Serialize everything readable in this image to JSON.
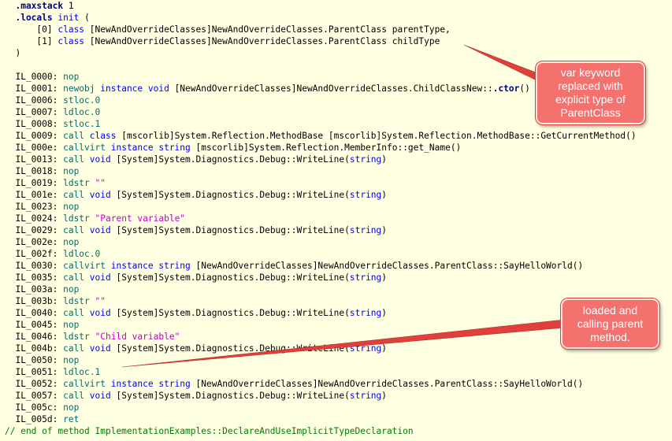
{
  "code_lines": [
    [
      [
        "t-dir",
        "  .maxstack"
      ],
      [
        "t-dk",
        " 1"
      ]
    ],
    [
      [
        "t-dir",
        "  .locals"
      ],
      [
        "t-dk",
        " "
      ],
      [
        "t-kw",
        "init"
      ],
      [
        "t-dk",
        " ("
      ]
    ],
    [
      [
        "t-dk",
        "      [0] "
      ],
      [
        "t-kw",
        "class"
      ],
      [
        "t-dk",
        " [NewAndOverrideClasses]NewAndOverrideClasses.ParentClass parentType,"
      ]
    ],
    [
      [
        "t-dk",
        "      [1] "
      ],
      [
        "t-kw",
        "class"
      ],
      [
        "t-dk",
        " [NewAndOverrideClasses]NewAndOverrideClasses.ParentClass childType"
      ]
    ],
    [
      [
        "t-dk",
        "  )"
      ]
    ],
    [
      [
        "t-dk",
        ""
      ]
    ],
    [
      [
        "t-dk",
        "  IL_0000: "
      ],
      [
        "t-op",
        "nop"
      ]
    ],
    [
      [
        "t-dk",
        "  IL_0001: "
      ],
      [
        "t-op",
        "newobj"
      ],
      [
        "t-dk",
        " "
      ],
      [
        "t-kw",
        "instance void"
      ],
      [
        "t-dk",
        " [NewAndOverrideClasses]NewAndOverrideClasses.ChildClassNew::"
      ],
      [
        "t-dir",
        ".ctor"
      ],
      [
        "t-dk",
        "()"
      ]
    ],
    [
      [
        "t-dk",
        "  IL_0006: "
      ],
      [
        "t-op",
        "stloc.0"
      ]
    ],
    [
      [
        "t-dk",
        "  IL_0007: "
      ],
      [
        "t-op",
        "ldloc.0"
      ]
    ],
    [
      [
        "t-dk",
        "  IL_0008: "
      ],
      [
        "t-op",
        "stloc.1"
      ]
    ],
    [
      [
        "t-dk",
        "  IL_0009: "
      ],
      [
        "t-op",
        "call"
      ],
      [
        "t-dk",
        " "
      ],
      [
        "t-kw",
        "class"
      ],
      [
        "t-dk",
        " [mscorlib]System.Reflection.MethodBase [mscorlib]System.Reflection.MethodBase::GetCurrentMethod()"
      ]
    ],
    [
      [
        "t-dk",
        "  IL_000e: "
      ],
      [
        "t-op",
        "callvirt"
      ],
      [
        "t-dk",
        " "
      ],
      [
        "t-kw",
        "instance string"
      ],
      [
        "t-dk",
        " [mscorlib]System.Reflection.MemberInfo::get_Name()"
      ]
    ],
    [
      [
        "t-dk",
        "  IL_0013: "
      ],
      [
        "t-op",
        "call"
      ],
      [
        "t-dk",
        " "
      ],
      [
        "t-kw",
        "void"
      ],
      [
        "t-dk",
        " [System]System.Diagnostics.Debug::WriteLine("
      ],
      [
        "t-kw",
        "string"
      ],
      [
        "t-dk",
        ")"
      ]
    ],
    [
      [
        "t-dk",
        "  IL_0018: "
      ],
      [
        "t-op",
        "nop"
      ]
    ],
    [
      [
        "t-dk",
        "  IL_0019: "
      ],
      [
        "t-op",
        "ldstr"
      ],
      [
        "t-dk",
        " "
      ],
      [
        "t-str",
        "\"\""
      ]
    ],
    [
      [
        "t-dk",
        "  IL_001e: "
      ],
      [
        "t-op",
        "call"
      ],
      [
        "t-dk",
        " "
      ],
      [
        "t-kw",
        "void"
      ],
      [
        "t-dk",
        " [System]System.Diagnostics.Debug::WriteLine("
      ],
      [
        "t-kw",
        "string"
      ],
      [
        "t-dk",
        ")"
      ]
    ],
    [
      [
        "t-dk",
        "  IL_0023: "
      ],
      [
        "t-op",
        "nop"
      ]
    ],
    [
      [
        "t-dk",
        "  IL_0024: "
      ],
      [
        "t-op",
        "ldstr"
      ],
      [
        "t-dk",
        " "
      ],
      [
        "t-str",
        "\"Parent variable\""
      ]
    ],
    [
      [
        "t-dk",
        "  IL_0029: "
      ],
      [
        "t-op",
        "call"
      ],
      [
        "t-dk",
        " "
      ],
      [
        "t-kw",
        "void"
      ],
      [
        "t-dk",
        " [System]System.Diagnostics.Debug::WriteLine("
      ],
      [
        "t-kw",
        "string"
      ],
      [
        "t-dk",
        ")"
      ]
    ],
    [
      [
        "t-dk",
        "  IL_002e: "
      ],
      [
        "t-op",
        "nop"
      ]
    ],
    [
      [
        "t-dk",
        "  IL_002f: "
      ],
      [
        "t-op",
        "ldloc.0"
      ]
    ],
    [
      [
        "t-dk",
        "  IL_0030: "
      ],
      [
        "t-op",
        "callvirt"
      ],
      [
        "t-dk",
        " "
      ],
      [
        "t-kw",
        "instance string"
      ],
      [
        "t-dk",
        " [NewAndOverrideClasses]NewAndOverrideClasses.ParentClass::SayHelloWorld()"
      ]
    ],
    [
      [
        "t-dk",
        "  IL_0035: "
      ],
      [
        "t-op",
        "call"
      ],
      [
        "t-dk",
        " "
      ],
      [
        "t-kw",
        "void"
      ],
      [
        "t-dk",
        " [System]System.Diagnostics.Debug::WriteLine("
      ],
      [
        "t-kw",
        "string"
      ],
      [
        "t-dk",
        ")"
      ]
    ],
    [
      [
        "t-dk",
        "  IL_003a: "
      ],
      [
        "t-op",
        "nop"
      ]
    ],
    [
      [
        "t-dk",
        "  IL_003b: "
      ],
      [
        "t-op",
        "ldstr"
      ],
      [
        "t-dk",
        " "
      ],
      [
        "t-str",
        "\"\""
      ]
    ],
    [
      [
        "t-dk",
        "  IL_0040: "
      ],
      [
        "t-op",
        "call"
      ],
      [
        "t-dk",
        " "
      ],
      [
        "t-kw",
        "void"
      ],
      [
        "t-dk",
        " [System]System.Diagnostics.Debug::WriteLine("
      ],
      [
        "t-kw",
        "string"
      ],
      [
        "t-dk",
        ")"
      ]
    ],
    [
      [
        "t-dk",
        "  IL_0045: "
      ],
      [
        "t-op",
        "nop"
      ]
    ],
    [
      [
        "t-dk",
        "  IL_0046: "
      ],
      [
        "t-op",
        "ldstr"
      ],
      [
        "t-dk",
        " "
      ],
      [
        "t-str",
        "\"Child variable\""
      ]
    ],
    [
      [
        "t-dk",
        "  IL_004b: "
      ],
      [
        "t-op",
        "call"
      ],
      [
        "t-dk",
        " "
      ],
      [
        "t-kw",
        "void"
      ],
      [
        "t-dk",
        " [System]System.Diagnostics.Debug::WriteLine("
      ],
      [
        "t-kw",
        "string"
      ],
      [
        "t-dk",
        ")"
      ]
    ],
    [
      [
        "t-dk",
        "  IL_0050: "
      ],
      [
        "t-op",
        "nop"
      ]
    ],
    [
      [
        "t-dk",
        "  IL_0051: "
      ],
      [
        "t-op",
        "ldloc.1"
      ]
    ],
    [
      [
        "t-dk",
        "  IL_0052: "
      ],
      [
        "t-op",
        "callvirt"
      ],
      [
        "t-dk",
        " "
      ],
      [
        "t-kw",
        "instance string"
      ],
      [
        "t-dk",
        " [NewAndOverrideClasses]NewAndOverrideClasses.ParentClass::SayHelloWorld()"
      ]
    ],
    [
      [
        "t-dk",
        "  IL_0057: "
      ],
      [
        "t-op",
        "call"
      ],
      [
        "t-dk",
        " "
      ],
      [
        "t-kw",
        "void"
      ],
      [
        "t-dk",
        " [System]System.Diagnostics.Debug::WriteLine("
      ],
      [
        "t-kw",
        "string"
      ],
      [
        "t-dk",
        ")"
      ]
    ],
    [
      [
        "t-dk",
        "  IL_005c: "
      ],
      [
        "t-op",
        "nop"
      ]
    ],
    [
      [
        "t-dk",
        "  IL_005d: "
      ],
      [
        "t-op",
        "ret"
      ]
    ],
    [
      [
        "t-cm",
        "// end of method ImplementationExamples::DeclareAndUseImplicitTypeDeclaration"
      ]
    ]
  ],
  "callouts": {
    "top": "var keyword replaced with explicit type of ParentClass",
    "bottom": "loaded and calling parent method."
  },
  "colors": {
    "background": "#ffffe1",
    "callout_fill": "#f4716e",
    "arrow": "#e0403c"
  }
}
